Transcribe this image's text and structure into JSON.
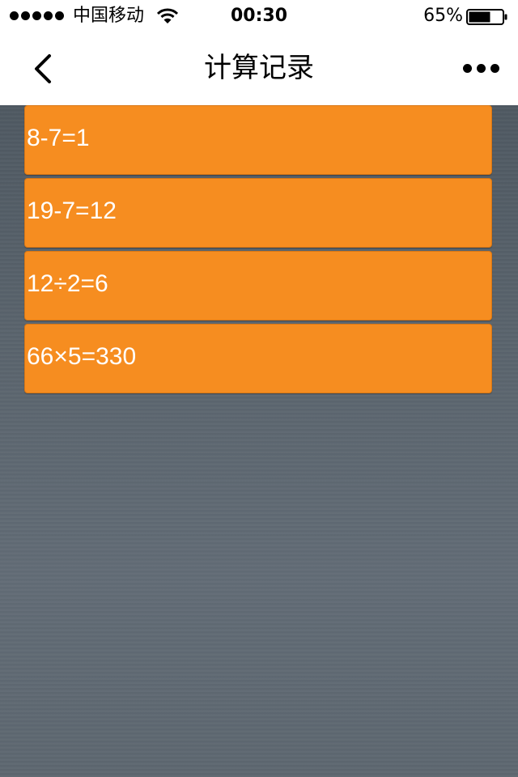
{
  "status_bar": {
    "carrier": "中国移动",
    "time": "00:30",
    "battery_percent": "65%",
    "battery_level": 0.65,
    "signal_bars": 5
  },
  "nav": {
    "title": "计算记录",
    "back_icon": "chevron-left-icon",
    "more_icon": "more-dots-icon"
  },
  "records": [
    {
      "expression": "8-7=1"
    },
    {
      "expression": "19-7=12"
    },
    {
      "expression": "12÷2=6"
    },
    {
      "expression": "66×5=330"
    }
  ],
  "colors": {
    "record_bg": "#f68d20",
    "content_bg": "#5a646d",
    "bar_bg": "#ffffff"
  }
}
